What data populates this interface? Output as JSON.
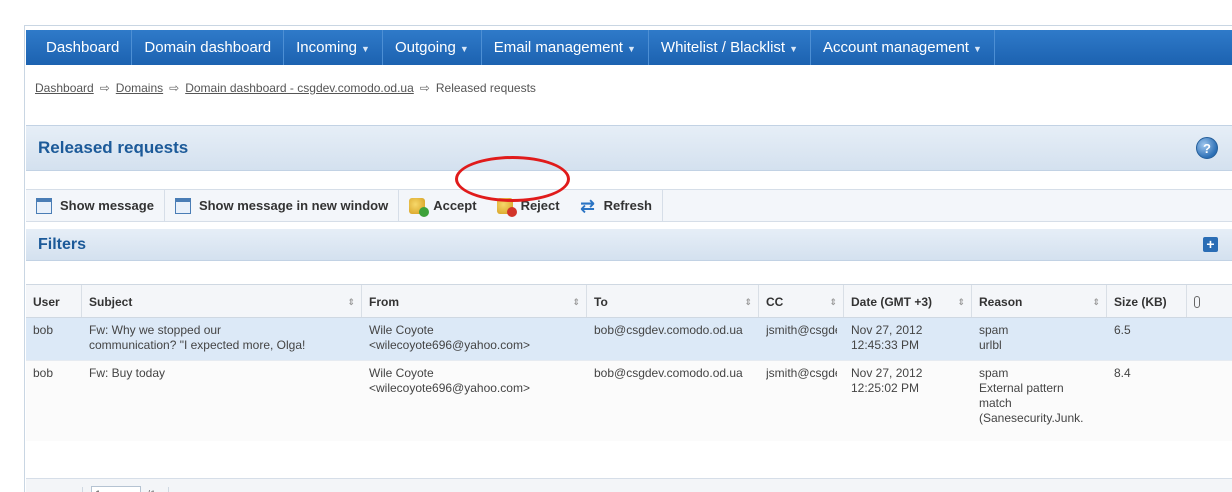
{
  "nav": {
    "items": [
      {
        "label": "Dashboard",
        "has_menu": false
      },
      {
        "label": "Domain dashboard",
        "has_menu": false
      },
      {
        "label": "Incoming",
        "has_menu": true
      },
      {
        "label": "Outgoing",
        "has_menu": true
      },
      {
        "label": "Email management",
        "has_menu": true
      },
      {
        "label": "Whitelist / Blacklist",
        "has_menu": true
      },
      {
        "label": "Account management",
        "has_menu": true
      }
    ],
    "caret": "▼"
  },
  "breadcrumb": {
    "items": [
      "Dashboard",
      "Domains",
      "Domain dashboard - csgdev.comodo.od.ua"
    ],
    "current": "Released requests",
    "separator": "⇨"
  },
  "panel": {
    "title": "Released requests",
    "help_glyph": "?"
  },
  "toolbar": {
    "show_message": "Show message",
    "show_message_new_window": "Show message in new window",
    "accept": "Accept",
    "reject": "Reject",
    "refresh": "Refresh"
  },
  "filters": {
    "label": "Filters",
    "expand_glyph": "+"
  },
  "grid": {
    "columns": {
      "user": "User",
      "subject": "Subject",
      "from": "From",
      "to": "To",
      "cc": "CC",
      "date": "Date (GMT +3)",
      "reason": "Reason",
      "size": "Size (KB)"
    },
    "rows": [
      {
        "user": "bob",
        "subject_1": "Fw: Why we stopped our",
        "subject_2": "communication? \"I expected more, Olga!",
        "from_1": "Wile Coyote",
        "from_2": "<wilecoyote696@yahoo.com>",
        "to": "bob@csgdev.comodo.od.ua",
        "cc": "jsmith@csgdev.comodo.od.ua",
        "date_1": "Nov 27, 2012",
        "date_2": "12:45:33 PM",
        "reason_1": "spam",
        "reason_2": "urlbl",
        "reason_3": "",
        "reason_4": "",
        "size": "6.5"
      },
      {
        "user": "bob",
        "subject_1": "Fw: Buy today",
        "subject_2": "",
        "from_1": "Wile Coyote",
        "from_2": "<wilecoyote696@yahoo.com>",
        "to": "bob@csgdev.comodo.od.ua",
        "cc": "jsmith@csgdev.comodo.od.ua",
        "date_1": "Nov 27, 2012",
        "date_2": "12:25:02 PM",
        "reason_1": "spam",
        "reason_2": "External pattern",
        "reason_3": "match",
        "reason_4": "(Sanesecurity.Junk.",
        "size": "8.4"
      }
    ]
  },
  "pager": {
    "page": "1",
    "total": "/1"
  },
  "colors": {
    "nav_bg": "#1c62b0",
    "title_text": "#1c5a99",
    "selected_row": "#dce9f7",
    "annotation_ring": "#e01b1b"
  }
}
